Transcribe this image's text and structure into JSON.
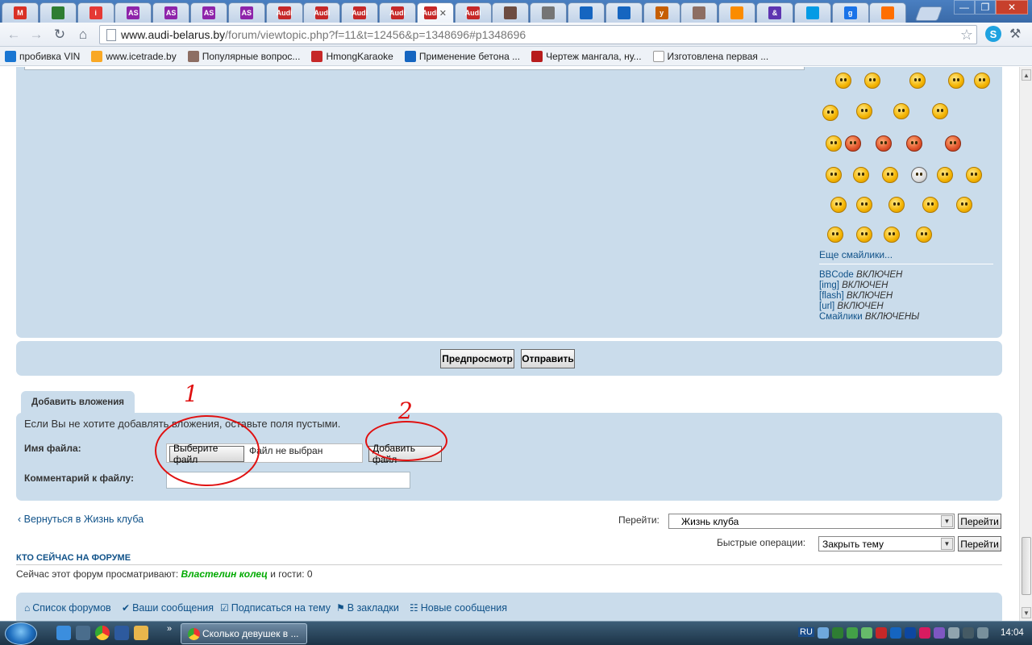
{
  "browser": {
    "tabs": [
      {
        "icon": "gmail-icon",
        "color": "#d93025",
        "text": "M"
      },
      {
        "icon": "belarus-emblem-icon",
        "color": "#2e7d32",
        "text": ""
      },
      {
        "icon": "info-icon",
        "color": "#e53935",
        "text": "i"
      },
      {
        "icon": "as-icon",
        "color": "#8e24aa",
        "text": "AS"
      },
      {
        "icon": "as-icon",
        "color": "#8e24aa",
        "text": "AS"
      },
      {
        "icon": "as-icon",
        "color": "#8e24aa",
        "text": "AS"
      },
      {
        "icon": "as-icon",
        "color": "#8e24aa",
        "text": "AS"
      },
      {
        "icon": "audi-icon",
        "color": "#c62828",
        "text": "Audi"
      },
      {
        "icon": "audi-icon",
        "color": "#c62828",
        "text": "Audi"
      },
      {
        "icon": "audi-icon",
        "color": "#c62828",
        "text": "Audi"
      },
      {
        "icon": "audi-icon",
        "color": "#c62828",
        "text": "Audi"
      },
      {
        "icon": "audi-icon",
        "color": "#c62828",
        "text": "Audi",
        "active": true
      },
      {
        "icon": "audi-icon",
        "color": "#c62828",
        "text": "Audi"
      },
      {
        "icon": "bird-icon",
        "color": "#6d4c41",
        "text": ""
      },
      {
        "icon": "mercedes-icon",
        "color": "#757575",
        "text": ""
      },
      {
        "icon": "game-icon",
        "color": "#1565c0",
        "text": ""
      },
      {
        "icon": "game-icon",
        "color": "#1565c0",
        "text": ""
      },
      {
        "icon": "yandex-icon",
        "color": "#c65e00",
        "text": "y"
      },
      {
        "icon": "ball-icon",
        "color": "#8d6e63",
        "text": ""
      },
      {
        "icon": "doll-icon",
        "color": "#fb8c00",
        "text": ""
      },
      {
        "icon": "ampersand-icon",
        "color": "#5e35b1",
        "text": "&"
      },
      {
        "icon": "arrow-icon",
        "color": "#039be5",
        "text": ""
      },
      {
        "icon": "google-icon",
        "color": "#1a73e8",
        "text": "g"
      },
      {
        "icon": "game-icon",
        "color": "#ff6f00",
        "text": ""
      }
    ],
    "url_host": "www.audi-belarus.by",
    "url_path": "/forum/viewtopic.php?f=11&t=12456&p=1348696#p1348696",
    "bookmarks": [
      {
        "label": "пробивка VIN",
        "color": "#1976d2"
      },
      {
        "label": "www.icetrade.by",
        "color": "#f9a825"
      },
      {
        "label": "Популярные вопрос...",
        "color": "#8d6e63"
      },
      {
        "label": "HmongKaraoke",
        "color": "#c62828"
      },
      {
        "label": "Применение бетона ...",
        "color": "#1565c0"
      },
      {
        "label": "Чертеж мангала, ну...",
        "color": "#b71c1c"
      },
      {
        "label": "Изготовлена первая ...",
        "color": "#ffffff"
      }
    ]
  },
  "post": {
    "more_smileys": "Еще смайлики...",
    "status": [
      {
        "name": "BBCode",
        "value": "ВКЛЮЧЕН"
      },
      {
        "name": "[img]",
        "value": "ВКЛЮЧЕН"
      },
      {
        "name": "[flash]",
        "value": "ВКЛЮЧЕН"
      },
      {
        "name": "[url]",
        "value": "ВКЛЮЧЕН"
      },
      {
        "name": "Смайлики",
        "value": "ВКЛЮЧЕНЫ"
      }
    ],
    "preview_label": "Предпросмотр",
    "submit_label": "Отправить"
  },
  "attachments": {
    "tab_label": "Добавить вложения",
    "note": "Если Вы не хотите добавлять вложения, оставьте поля пустыми.",
    "filename_label": "Имя файла:",
    "choose_file_label": "Выберите файл",
    "file_status": "Файл не выбран",
    "add_file_label": "Добавить файл",
    "comment_label": "Комментарий к файлу:",
    "annotation_1": "1",
    "annotation_2": "2"
  },
  "nav": {
    "back_link": "Вернуться в Жизнь клуба",
    "jump_label": "Перейти:",
    "jump_value": "Жизнь клуба",
    "jump_go": "Перейти",
    "quick_label": "Быстрые операции:",
    "quick_value": "Закрыть тему",
    "quick_go": "Перейти"
  },
  "online": {
    "title": "КТО СЕЙЧАС НА ФОРУМЕ",
    "prefix": "Сейчас этот форум просматривают:",
    "user": "Властелин колец",
    "suffix": "и гости: 0"
  },
  "footer_links": [
    {
      "label": "Список форумов",
      "icon": "home-icon"
    },
    {
      "label": "Ваши сообщения",
      "icon": "check-icon"
    },
    {
      "label": "Подписаться на тему",
      "icon": "checkbox-icon"
    },
    {
      "label": "В закладки",
      "icon": "bookmark-icon"
    },
    {
      "label": "Новые сообщения",
      "icon": "messages-icon"
    }
  ],
  "taskbar": {
    "task_title": "Сколько девушек в ...",
    "lang": "RU",
    "clock": "14:04"
  }
}
